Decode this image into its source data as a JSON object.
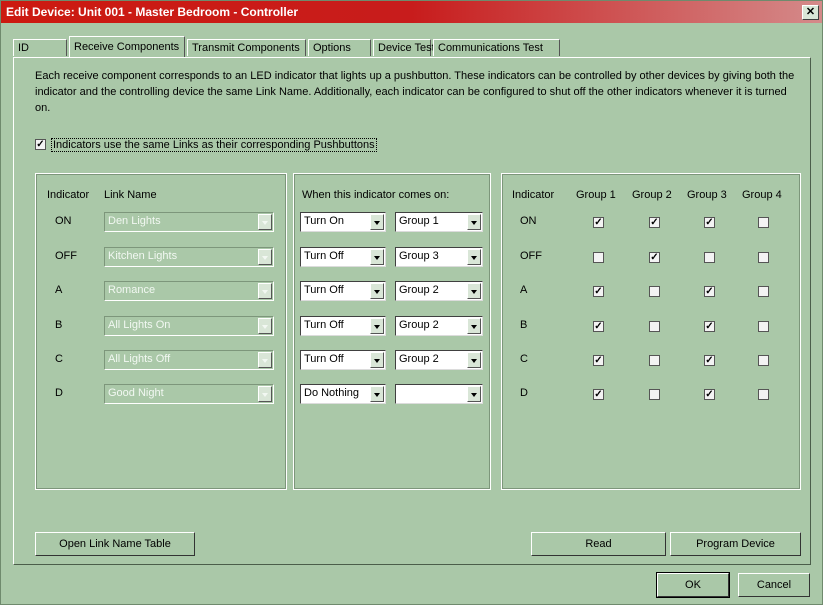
{
  "window": {
    "title": "Edit Device: Unit 001 - Master Bedroom - Controller",
    "close_glyph": "✕"
  },
  "tabs": [
    {
      "label": "ID"
    },
    {
      "label": "Receive Components"
    },
    {
      "label": "Transmit Components"
    },
    {
      "label": "Options"
    },
    {
      "label": "Device Test"
    },
    {
      "label": "Communications Test"
    }
  ],
  "active_tab": "Receive Components",
  "description": "Each receive component corresponds to an LED indicator that lights up a pushbutton.  These indicators can be controlled by other devices by giving both the indicator and the controlling device the same Link Name.  Additionally, each indicator can be configured to shut off the other indicators whenever it is turned on.",
  "same_links": {
    "label": "Indicators use the same Links as their corresponding Pushbuttons",
    "checked": true
  },
  "left_panel": {
    "indicator_header": "Indicator",
    "link_header": "Link Name"
  },
  "middle_panel": {
    "header": "When this indicator comes on:"
  },
  "right_panel": {
    "indicator_header": "Indicator",
    "group_headers": [
      "Group 1",
      "Group 2",
      "Group 3",
      "Group 4"
    ]
  },
  "check_glyph": "✓",
  "rows": [
    {
      "indicator": "ON",
      "link": "Den Lights",
      "action": "Turn On",
      "group": "Group 1",
      "groups": [
        true,
        true,
        true,
        false
      ]
    },
    {
      "indicator": "OFF",
      "link": "Kitchen Lights",
      "action": "Turn Off",
      "group": "Group 3",
      "groups": [
        false,
        true,
        false,
        false
      ]
    },
    {
      "indicator": "A",
      "link": "Romance",
      "action": "Turn Off",
      "group": "Group 2",
      "groups": [
        true,
        false,
        true,
        false
      ]
    },
    {
      "indicator": "B",
      "link": "All Lights On",
      "action": "Turn Off",
      "group": "Group 2",
      "groups": [
        true,
        false,
        true,
        false
      ]
    },
    {
      "indicator": "C",
      "link": "All Lights Off",
      "action": "Turn Off",
      "group": "Group 2",
      "groups": [
        true,
        false,
        true,
        false
      ]
    },
    {
      "indicator": "D",
      "link": "Good Night",
      "action": "Do Nothing",
      "group": "",
      "groups": [
        true,
        false,
        true,
        false
      ]
    }
  ],
  "buttons": {
    "open_link_table": "Open Link Name Table",
    "read": "Read",
    "program_device": "Program Device",
    "ok": "OK",
    "cancel": "Cancel"
  }
}
